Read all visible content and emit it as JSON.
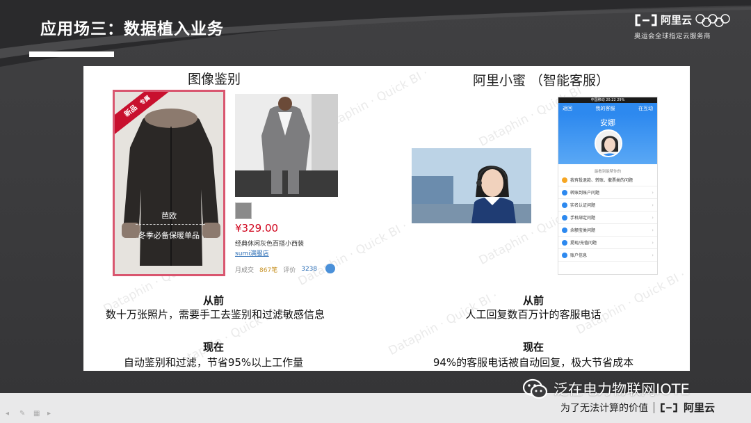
{
  "slide": {
    "title": "应用场三：数据植入业务"
  },
  "header_logo": {
    "brand": "阿里云",
    "subtitle": "奥运会全球指定云服务商"
  },
  "panel": {
    "watermark": "Dataphin · Quick BI ·",
    "left": {
      "section_title": "图像鉴别",
      "coat_badge": "新品",
      "coat_badge_tag": "专属",
      "coat_brand": "芭欧",
      "coat_tagline": "冬季必备保暖单品",
      "price": "¥329.00",
      "product_name": "经典休闲灰色百搭小西装",
      "shop_name": "sumi演服店",
      "stats_sales_label": "月成交",
      "stats_sales_value": "867笔",
      "stats_rating_label": "评价",
      "stats_rating_value": "3238",
      "before_head": "从前",
      "before_body": "数十万张照片，需要手工去鉴别和过滤敏感信息",
      "now_head": "现在",
      "now_body": "自动鉴别和过滤，节省95%以上工作量"
    },
    "right": {
      "section_title": "阿里小蜜 （智能客服）",
      "phone": {
        "status": "中国移动  20:22  29%",
        "nav_back": "返回",
        "nav_title": "我的客服",
        "nav_action": "在互动",
        "agent_name": "安娜",
        "hint": "最看到能帮你的",
        "items": [
          "我有投退款、转账、撤票类的问题",
          "转账到账户问题",
          "实名认证问题",
          "手机绑定问题",
          "余额宝类问题",
          "提现/充值问题",
          "账户信息"
        ]
      },
      "before_head": "从前",
      "before_body": "人工回复数百万计的客服电话",
      "now_head": "现在",
      "now_body": "94%的客服电话被自动回复，极大节省成本"
    }
  },
  "footer": {
    "wechat_account": "泛在电力物联网IOTE",
    "slogan": "为了无法计算的价值",
    "brand": "阿里云"
  }
}
